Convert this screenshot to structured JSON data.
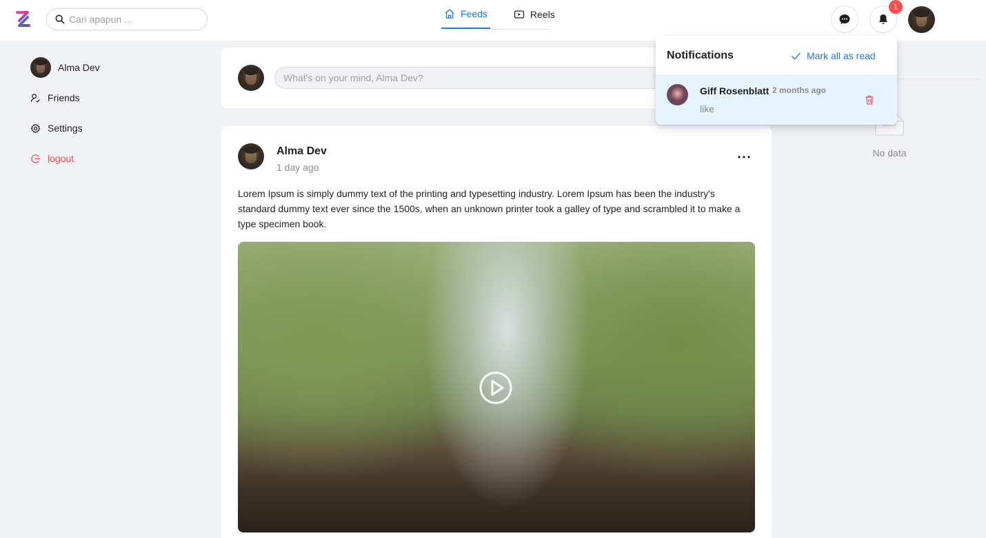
{
  "header": {
    "search_placeholder": "Cari apapun ...",
    "tabs": [
      {
        "label": "Feeds",
        "icon": "home-icon",
        "active": true
      },
      {
        "label": "Reels",
        "icon": "video-icon",
        "active": false
      }
    ],
    "notification_count": "1",
    "accent_color": "#1677ff"
  },
  "sidebar": {
    "user_name": "Alma Dev",
    "items": [
      {
        "label": "Friends",
        "icon": "friends-icon"
      },
      {
        "label": "Settings",
        "icon": "gear-icon"
      },
      {
        "label": "logout",
        "icon": "logout-icon",
        "color": "#ff4d4f"
      }
    ]
  },
  "composer": {
    "placeholder": "What's on your mind, Alma Dev?"
  },
  "post": {
    "author": "Alma Dev",
    "time": "1 day ago",
    "text": "Lorem Ipsum is simply dummy text of the printing and typesetting industry. Lorem Ipsum has been the industry's standard dummy text ever since the 1500s, when an unknown printer took a galley of type and scrambled it to make a type specimen book.",
    "media": "video"
  },
  "right_rail": {
    "empty_text": "No data"
  },
  "notifications": {
    "title": "Notifications",
    "mark_all_label": "Mark all as read",
    "items": [
      {
        "name": "Giff Rosenblatt",
        "time": "2 months ago",
        "message": "like"
      }
    ]
  }
}
